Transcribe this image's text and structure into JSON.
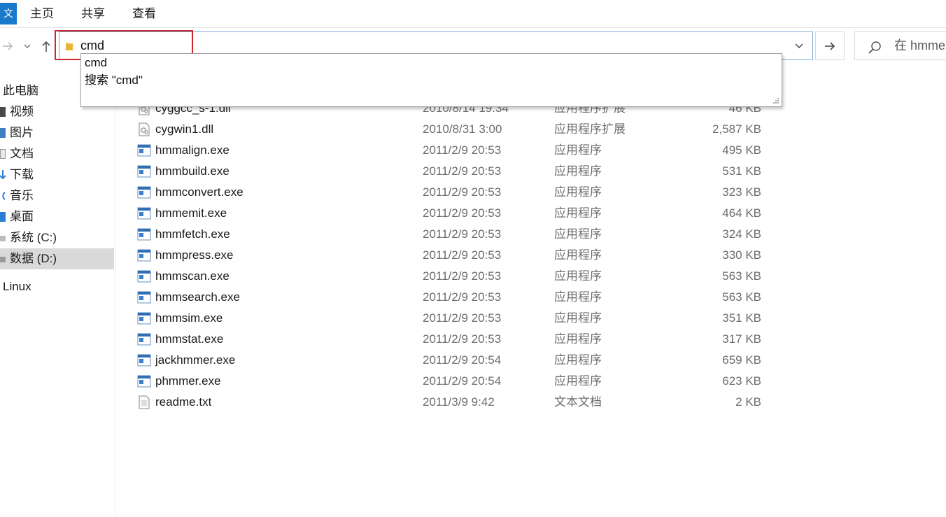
{
  "ribbon": {
    "file_tab_glyph": "文",
    "tabs": [
      "主页",
      "共享",
      "查看"
    ]
  },
  "address_bar": {
    "value": "cmd",
    "folder_icon": "folder-icon",
    "dropdown_icon": "chevron-down-icon",
    "go_icon": "arrow-right-icon"
  },
  "search": {
    "placeholder": "在 hmme",
    "icon": "search-icon"
  },
  "autocomplete": {
    "items": [
      "cmd",
      "搜索 \"cmd\""
    ]
  },
  "sidebar": {
    "items": [
      {
        "label": "此电脑",
        "icon": "this-pc-icon",
        "selected": false
      },
      {
        "label": "视频",
        "icon": "videos-icon",
        "selected": false
      },
      {
        "label": "图片",
        "icon": "pictures-icon",
        "selected": false
      },
      {
        "label": "文档",
        "icon": "documents-icon",
        "selected": false
      },
      {
        "label": "下载",
        "icon": "downloads-icon",
        "selected": false
      },
      {
        "label": "音乐",
        "icon": "music-icon",
        "selected": false
      },
      {
        "label": "桌面",
        "icon": "desktop-icon",
        "selected": false
      },
      {
        "label": "系统 (C:)",
        "icon": "drive-icon",
        "selected": false
      },
      {
        "label": "数据 (D:)",
        "icon": "drive-icon",
        "selected": true
      },
      {
        "label": "Linux",
        "icon": "linux-icon",
        "selected": false
      }
    ]
  },
  "files": [
    {
      "name": "cyggcc_s-1.dll",
      "date": "2010/8/14 19:34",
      "type": "应用程序扩展",
      "size": "46 KB",
      "icon": "dll-icon"
    },
    {
      "name": "cygwin1.dll",
      "date": "2010/8/31 3:00",
      "type": "应用程序扩展",
      "size": "2,587 KB",
      "icon": "dll-icon"
    },
    {
      "name": "hmmalign.exe",
      "date": "2011/2/9 20:53",
      "type": "应用程序",
      "size": "495 KB",
      "icon": "exe-icon"
    },
    {
      "name": "hmmbuild.exe",
      "date": "2011/2/9 20:53",
      "type": "应用程序",
      "size": "531 KB",
      "icon": "exe-icon"
    },
    {
      "name": "hmmconvert.exe",
      "date": "2011/2/9 20:53",
      "type": "应用程序",
      "size": "323 KB",
      "icon": "exe-icon"
    },
    {
      "name": "hmmemit.exe",
      "date": "2011/2/9 20:53",
      "type": "应用程序",
      "size": "464 KB",
      "icon": "exe-icon"
    },
    {
      "name": "hmmfetch.exe",
      "date": "2011/2/9 20:53",
      "type": "应用程序",
      "size": "324 KB",
      "icon": "exe-icon"
    },
    {
      "name": "hmmpress.exe",
      "date": "2011/2/9 20:53",
      "type": "应用程序",
      "size": "330 KB",
      "icon": "exe-icon"
    },
    {
      "name": "hmmscan.exe",
      "date": "2011/2/9 20:53",
      "type": "应用程序",
      "size": "563 KB",
      "icon": "exe-icon"
    },
    {
      "name": "hmmsearch.exe",
      "date": "2011/2/9 20:53",
      "type": "应用程序",
      "size": "563 KB",
      "icon": "exe-icon"
    },
    {
      "name": "hmmsim.exe",
      "date": "2011/2/9 20:53",
      "type": "应用程序",
      "size": "351 KB",
      "icon": "exe-icon"
    },
    {
      "name": "hmmstat.exe",
      "date": "2011/2/9 20:53",
      "type": "应用程序",
      "size": "317 KB",
      "icon": "exe-icon"
    },
    {
      "name": "jackhmmer.exe",
      "date": "2011/2/9 20:54",
      "type": "应用程序",
      "size": "659 KB",
      "icon": "exe-icon"
    },
    {
      "name": "phmmer.exe",
      "date": "2011/2/9 20:54",
      "type": "应用程序",
      "size": "623 KB",
      "icon": "exe-icon"
    },
    {
      "name": "readme.txt",
      "date": "2011/3/9 9:42",
      "type": "文本文档",
      "size": "2 KB",
      "icon": "text-file-icon"
    }
  ],
  "colors": {
    "accent": "#1979ca",
    "highlight_box": "#c9282e",
    "selected_bg": "#d9d9d9",
    "address_border": "#7aa9d9"
  }
}
